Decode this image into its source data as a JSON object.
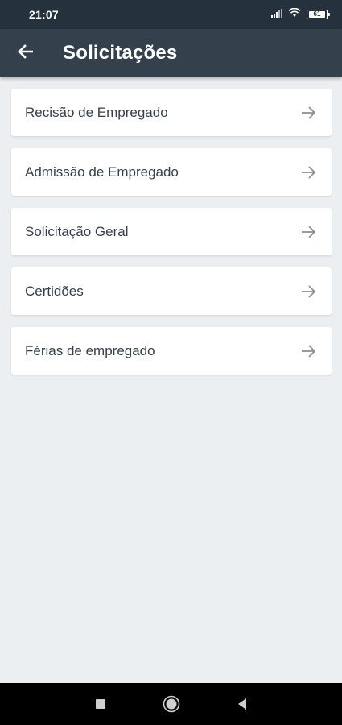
{
  "status_bar": {
    "time": "21:07",
    "battery_level": "61",
    "icons": [
      "signal-icon",
      "wifi-icon",
      "battery-icon"
    ]
  },
  "app_bar": {
    "title": "Solicitações",
    "back_icon": "arrow-left-icon",
    "background": "#35404d"
  },
  "list": {
    "items": [
      {
        "label": "Recisão de Empregado"
      },
      {
        "label": "Admissão de Empregado"
      },
      {
        "label": "Solicitação Geral"
      },
      {
        "label": "Certidões"
      },
      {
        "label": "Férias de empregado"
      }
    ],
    "item_icon": "arrow-right-icon"
  },
  "nav_bar": {
    "buttons": [
      "recents-square-icon",
      "home-circle-icon",
      "back-triangle-icon"
    ]
  },
  "colors": {
    "status_bar": "#26313e",
    "app_bar": "#35404d",
    "background": "#eceff1",
    "card": "#ffffff",
    "text": "#37404a",
    "arrow": "#8a8f95"
  }
}
